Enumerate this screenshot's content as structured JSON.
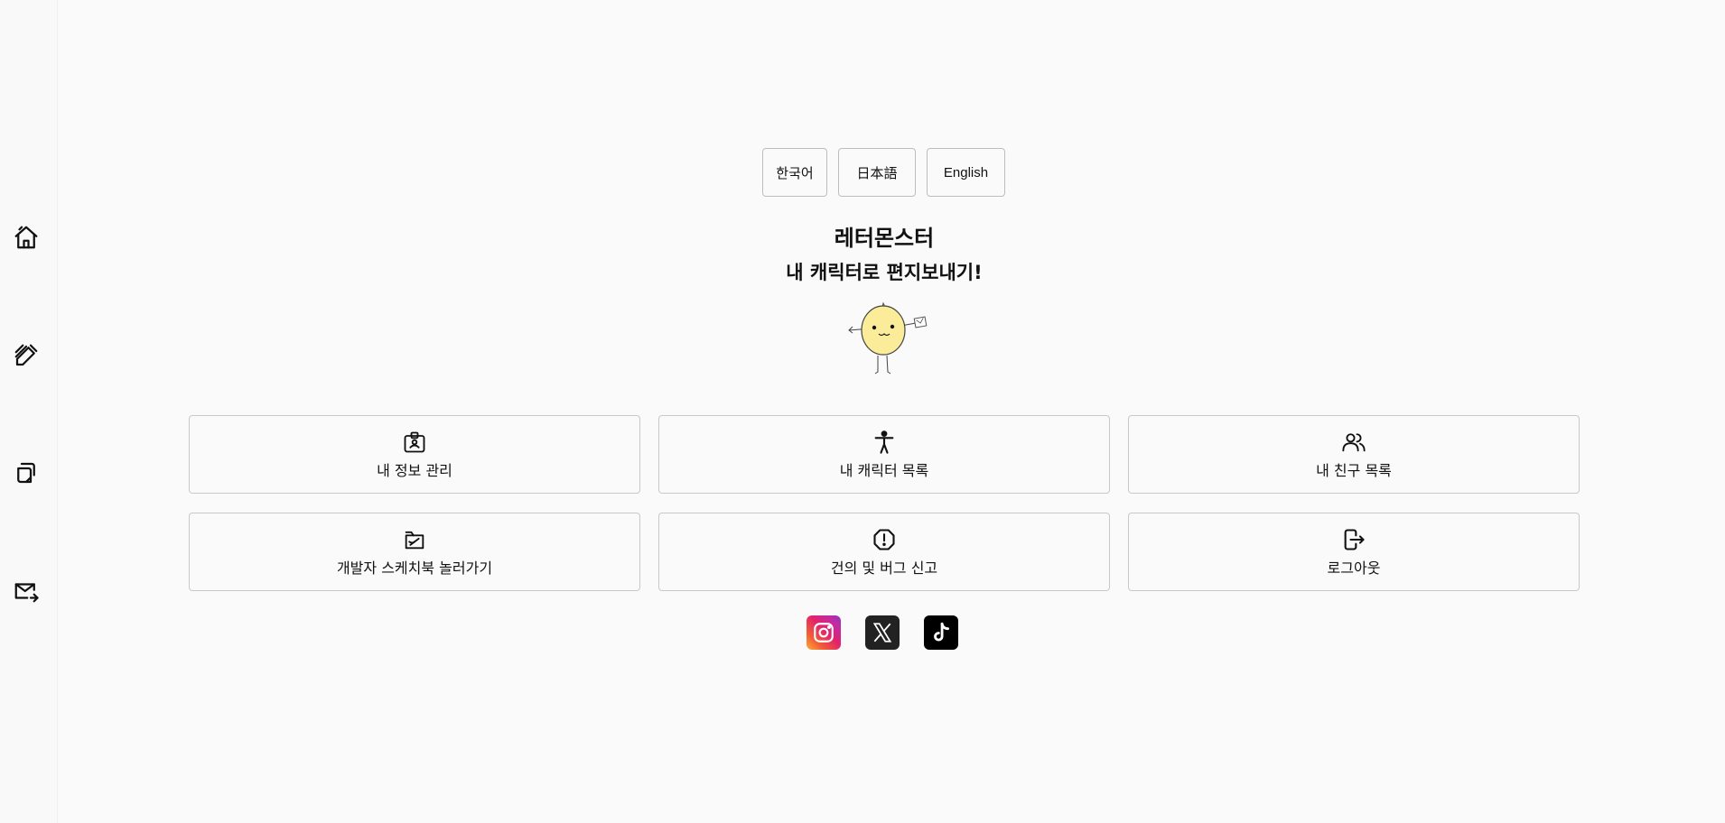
{
  "sidebar": {
    "items": [
      {
        "icon": "home-icon"
      },
      {
        "icon": "write-icon"
      },
      {
        "icon": "copy-icon"
      },
      {
        "icon": "mail-send-icon"
      }
    ]
  },
  "languages": {
    "korean": "한국어",
    "japanese": "日本語",
    "english": "English"
  },
  "header": {
    "title": "레터몬스터",
    "subtitle": "내 캐릭터로 편지보내기!"
  },
  "menu": {
    "items": [
      {
        "label": "내 정보 관리",
        "icon": "id-card-icon"
      },
      {
        "label": "내 캐릭터 목록",
        "icon": "person-icon"
      },
      {
        "label": "내 친구 목록",
        "icon": "users-icon"
      },
      {
        "label": "개발자 스케치북 놀러가기",
        "icon": "sketchbook-icon"
      },
      {
        "label": "건의 및 버그 신고",
        "icon": "alert-icon"
      },
      {
        "label": "로그아웃",
        "icon": "logout-icon"
      }
    ]
  },
  "social": {
    "items": [
      "instagram-icon",
      "x-icon",
      "tiktok-icon"
    ]
  },
  "colors": {
    "background": "#fafafa",
    "border": "#c8c8c8",
    "mascot": "#fbec9a"
  }
}
